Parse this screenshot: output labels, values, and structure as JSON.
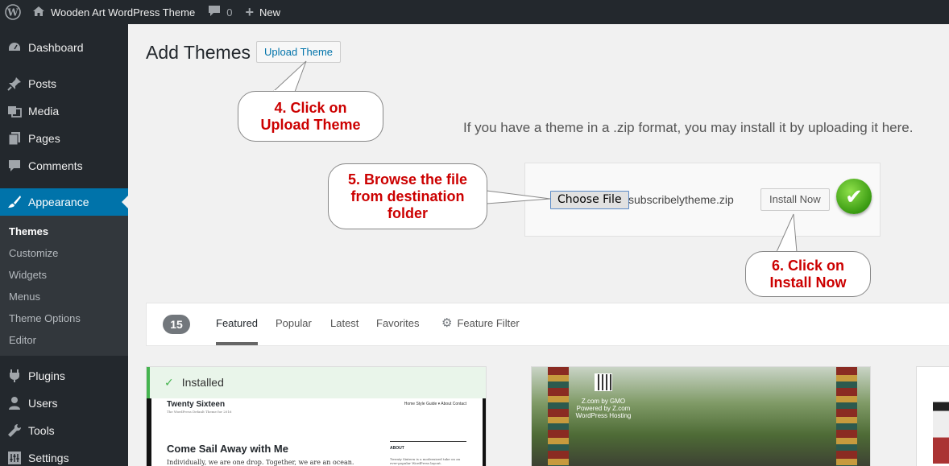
{
  "adminbar": {
    "site_name": "Wooden Art WordPress Theme",
    "comments_count": "0",
    "new_label": "New"
  },
  "sidebar": {
    "items": [
      {
        "label": "Dashboard",
        "icon": "dashboard-icon"
      },
      {
        "label": "Posts",
        "icon": "pin-icon"
      },
      {
        "label": "Media",
        "icon": "media-icon"
      },
      {
        "label": "Pages",
        "icon": "pages-icon"
      },
      {
        "label": "Comments",
        "icon": "comment-icon"
      },
      {
        "label": "Appearance",
        "icon": "brush-icon"
      },
      {
        "label": "Plugins",
        "icon": "plug-icon"
      },
      {
        "label": "Users",
        "icon": "user-icon"
      },
      {
        "label": "Tools",
        "icon": "wrench-icon"
      },
      {
        "label": "Settings",
        "icon": "settings-icon"
      }
    ],
    "submenu": [
      "Themes",
      "Customize",
      "Widgets",
      "Menus",
      "Theme Options",
      "Editor"
    ]
  },
  "main": {
    "title": "Add Themes",
    "upload_button": "Upload Theme",
    "upload_text": "If you have a theme in a .zip format, you may install it by uploading it here.",
    "choose_file": "Choose File",
    "filename": "subscribelytheme.zip",
    "install_button": "Install Now"
  },
  "callouts": {
    "c1": [
      "4. Click on",
      "Upload Theme"
    ],
    "c2": [
      "5. Browse the file",
      "from destination",
      "folder"
    ],
    "c3": [
      "6. Click on",
      "Install Now"
    ]
  },
  "filter": {
    "count": "15",
    "tabs": [
      "Featured",
      "Popular",
      "Latest",
      "Favorites"
    ],
    "feature_filter": "Feature Filter"
  },
  "cards": {
    "installed": "Installed",
    "twenty_sixteen": {
      "title": "Twenty Sixteen",
      "tagline": "The WordPress Default Theme for 2016",
      "nav": "Home    Style Guide ▾    About    Contact",
      "headline": "Come Sail Away with Me",
      "body": "Individually, we are one drop. Together, we are an ocean.",
      "about": "ABOUT",
      "about_text": "Twenty Sixteen is a modernized take on an ever-popular WordPress layout."
    },
    "zcom": [
      "Z.com by GMO",
      "Powered by Z.com",
      "WordPress Hosting"
    ]
  },
  "colors": {
    "accent": "#0073aa",
    "callout_text": "#cc0000",
    "installed_green": "#46b450"
  }
}
